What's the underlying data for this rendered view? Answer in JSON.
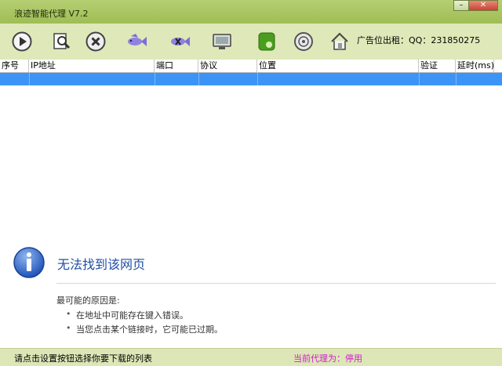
{
  "window": {
    "title": "浪迹智能代理 V7.2",
    "minimize_icon": "minimize-icon",
    "close_icon": "close-icon"
  },
  "toolbar": {
    "buttons": [
      {
        "icon": "play-icon"
      },
      {
        "icon": "search-document-icon"
      },
      {
        "icon": "stop-icon"
      },
      {
        "icon": "fish-icon"
      },
      {
        "icon": "fish-x-icon"
      },
      {
        "icon": "monitor-icon"
      },
      {
        "icon": "green-app-icon"
      },
      {
        "icon": "disc-icon"
      },
      {
        "icon": "home-icon"
      }
    ],
    "ad_text": "广告位出租：QQ：231850275"
  },
  "table": {
    "columns": [
      "序号",
      "IP地址",
      "端口",
      "协议",
      "位置",
      "验证",
      "延时(ms)"
    ],
    "rows": [
      []
    ]
  },
  "error_page": {
    "title": "无法找到该网页",
    "reasons_heading": "最可能的原因是:",
    "reasons": [
      "在地址中可能存在键入错误。",
      "当您点击某个链接时，它可能已过期。"
    ]
  },
  "status": {
    "left": "请点击设置按钮选择你要下载的列表",
    "right": "当前代理为：停用"
  },
  "colors": {
    "title_bar": "#a9c562",
    "toolbar": "#dfe8b8",
    "selection": "#3c94f6",
    "status_proxy": "#d21bd2",
    "error_title": "#1f4ea5"
  }
}
